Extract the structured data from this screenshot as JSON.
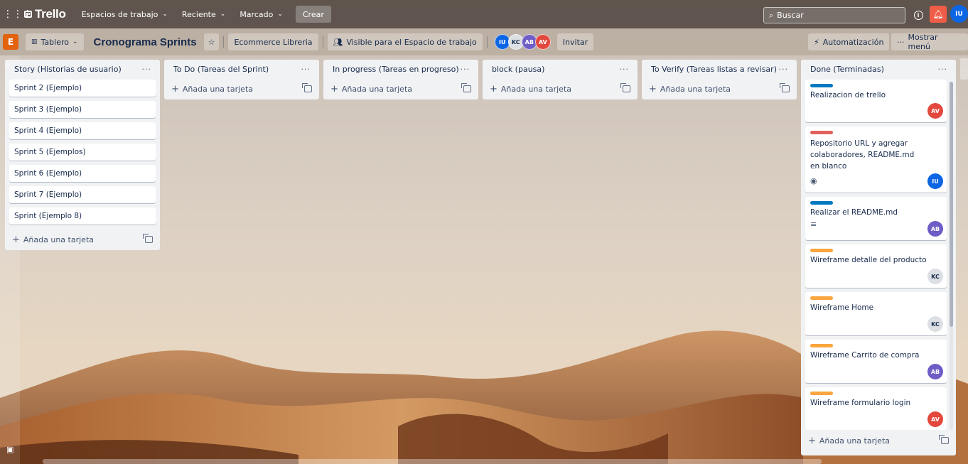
{
  "topnav": {
    "logo": "Trello",
    "items": [
      {
        "label": "Espacios de trabajo"
      },
      {
        "label": "Reciente"
      },
      {
        "label": "Marcado"
      }
    ],
    "create_label": "Crear",
    "search_placeholder": "Buscar",
    "user_initials": "IU"
  },
  "board": {
    "workspace_badge": "E",
    "view_label": "Tablero",
    "title": "Cronograma Sprints",
    "workspace_name": "Ecommerce Libreria",
    "visibility_label": "Visible para el Espacio de trabajo",
    "members": [
      {
        "initials": "IU",
        "color": "#0c66e4"
      },
      {
        "initials": "KC",
        "color": "#dcdfe4"
      },
      {
        "initials": "AB",
        "color": "#6e5dc6"
      },
      {
        "initials": "AV",
        "color": "#e2483d"
      }
    ],
    "invite_label": "Invitar",
    "automation_label": "Automatización",
    "show_menu_label": "Mostrar menú"
  },
  "add_card_label": "Añada una tarjeta",
  "lists": [
    {
      "title": "Story (Historias de usuario)",
      "cards": [
        {
          "title": "Sprint 2 (Ejemplo)"
        },
        {
          "title": "Sprint 3 (Ejemplo)"
        },
        {
          "title": "Sprint 4 (Ejemplo)"
        },
        {
          "title": "Sprint 5 (Ejemplos)"
        },
        {
          "title": "Sprint 6 (Ejemplo)"
        },
        {
          "title": "Sprint 7 (Ejemplo)"
        },
        {
          "title": "Sprint (Ejemplo 8)"
        }
      ]
    },
    {
      "title": "To Do (Tareas del Sprint)",
      "cards": []
    },
    {
      "title": "In progress (Tareas en progreso)",
      "cards": []
    },
    {
      "title": "block (pausa)",
      "cards": []
    },
    {
      "title": "To Verify (Tareas listas a revisar)",
      "cards": []
    },
    {
      "title": "Done (Terminadas)",
      "cards": [
        {
          "title": "Realizacion de trello",
          "label_color": "#0079bf",
          "member": "AV",
          "member_color": "#e2483d"
        },
        {
          "title": "Repositorio URL y agregar colaboradores, README.md en blanco",
          "label_color": "#e2625b",
          "member": "IU",
          "member_color": "#0c66e4",
          "badge": "eye-icon"
        },
        {
          "title": "Realizar el README.md",
          "label_color": "#0079bf",
          "member": "AB",
          "member_color": "#6e5dc6",
          "badge": "description-icon"
        },
        {
          "title": "Wireframe detalle del producto",
          "label_color": "#faa53d",
          "member": "KC",
          "member_color": "#dcdfe4"
        },
        {
          "title": "Wireframe Home",
          "label_color": "#faa53d",
          "member": "KC",
          "member_color": "#dcdfe4"
        },
        {
          "title": "Wireframe Carrito de compra",
          "label_color": "#faa53d",
          "member": "AB",
          "member_color": "#6e5dc6"
        },
        {
          "title": "Wireframe formulario login",
          "label_color": "#faa53d",
          "member": "AV",
          "member_color": "#e2483d"
        }
      ]
    }
  ]
}
